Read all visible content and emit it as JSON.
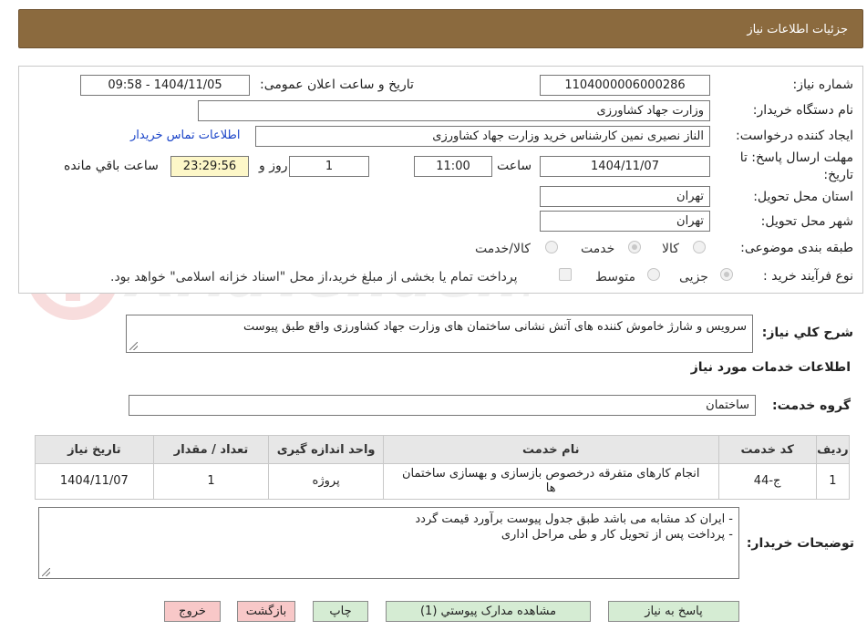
{
  "header": {
    "title": "جزئیات اطلاعات نیاز"
  },
  "form": {
    "need_number": {
      "label": "شماره نیاز:",
      "value": "1104000006000286"
    },
    "announce_datetime": {
      "label": "تاریخ و ساعت اعلان عمومی:",
      "value": "1404/11/05 - 09:58"
    },
    "buyer_org": {
      "label": "نام دستگاه خریدار:",
      "value": "وزارت جهاد کشاورزی"
    },
    "requester": {
      "label": "ایجاد کننده درخواست:",
      "value": "الناز نصیری نمین کارشناس خرید وزارت جهاد کشاورزی"
    },
    "contact_link": "اطلاعات تماس خریدار",
    "deadline": {
      "label_line1": "مهلت ارسال پاسخ: تا",
      "label_line2": "تاریخ:",
      "date": "1404/11/07",
      "time_label": "ساعت",
      "time": "11:00",
      "days": "1",
      "days_label": "روز و",
      "remaining": "23:29:56",
      "remaining_label": "ساعت باقي مانده"
    },
    "province": {
      "label": "استان محل تحویل:",
      "value": "تهران"
    },
    "city": {
      "label": "شهر محل تحویل:",
      "value": "تهران"
    },
    "category": {
      "label": "طبقه بندی موضوعی:",
      "options": [
        "کالا",
        "خدمت",
        "کالا/خدمت"
      ],
      "selected": "خدمت"
    },
    "process": {
      "label": "نوع فرآیند خرید :",
      "options": [
        "جزیی",
        "متوسط"
      ],
      "selected": "جزیی",
      "payment_note": "پرداخت تمام یا بخشی از مبلغ خرید،از محل \"اسناد خزانه اسلامی\" خواهد بود."
    }
  },
  "summary": {
    "label": "شرح کلي نياز:",
    "value": "سرویس و شارژ خاموش کننده های آتش نشانی ساختمان های وزارت جهاد کشاورزی واقع طبق پیوست"
  },
  "services_section": {
    "title": "اطلاعات خدمات مورد نياز",
    "group_label": "گروه خدمت:",
    "group_value": "ساختمان"
  },
  "table": {
    "headers": [
      "رديف",
      "كد خدمت",
      "نام خدمت",
      "واحد اندازه گیری",
      "تعداد / مقدار",
      "تاريخ نياز"
    ],
    "rows": [
      {
        "index": "1",
        "code": "ج-44",
        "name": "انجام کارهای متفرقه درخصوص بازسازی و بهسازی ساختمان ها",
        "unit": "پروژه",
        "qty": "1",
        "date": "1404/11/07"
      }
    ]
  },
  "notes": {
    "label": "توضیحات خریدار:",
    "line1": "- ایران کد مشابه می باشد طبق جدول پیوست برآورد قیمت گردد",
    "line2": "- پرداخت پس از تحویل کار و طی مراحل اداری"
  },
  "buttons": {
    "reply": "پاسخ به نیاز",
    "attachments": "مشاهده مدارک پیوستي (1)",
    "print": "چاپ",
    "back": "بازگشت",
    "exit": "خروج"
  },
  "watermark": {
    "text": "AriaTender.neT"
  },
  "colors": {
    "header_bg": "#8b6a3e",
    "button_green": "#d5ecd3",
    "button_pink": "#f8c8c8",
    "link": "#1a44c8",
    "timer_bg": "#fdf7c8"
  }
}
